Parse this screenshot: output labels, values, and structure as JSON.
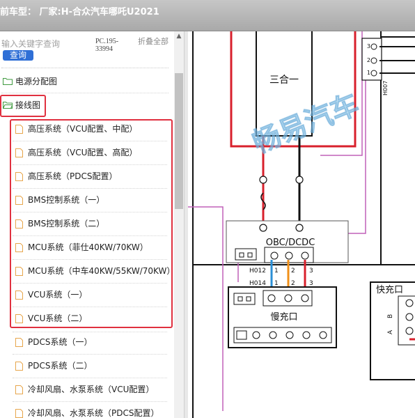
{
  "header": {
    "title": "前车型：  厂家:H-合众汽车哪吒U2021"
  },
  "search": {
    "placeholder": "输入关键字查询",
    "button_label": "查询",
    "pc_code": "PC.195-33994",
    "collapse_label": "折叠全部"
  },
  "tree": {
    "folders": [
      {
        "label": "电源分配图"
      },
      {
        "label": "接线图"
      }
    ],
    "documents": [
      {
        "label": "高压系统（VCU配置、中配）"
      },
      {
        "label": "高压系统（VCU配置、高配）"
      },
      {
        "label": "高压系统（PDCS配置）"
      },
      {
        "label": "BMS控制系统（一）"
      },
      {
        "label": "BMS控制系统（二）"
      },
      {
        "label": "MCU系统（菲仕40KW/70KW）"
      },
      {
        "label": "MCU系统（中车40KW/55KW/70KW）"
      },
      {
        "label": "VCU系统（一）"
      },
      {
        "label": "VCU系统（二）"
      },
      {
        "label": "PDCS系统（一）"
      },
      {
        "label": "PDCS系统（二）"
      },
      {
        "label": "冷却风扇、水泵系统（VCU配置）"
      },
      {
        "label": "冷却风扇、水泵系统（PDCS配置）"
      }
    ]
  },
  "diagram": {
    "module_sanheyi": "三合一",
    "module_obc": "OBC/DCDC",
    "connector_h007": "H007",
    "connector_h012": "H012",
    "connector_h014": "H014",
    "pin_1": "1",
    "pin_2": "2",
    "pin_3": "3",
    "slow_charge": "慢充口",
    "fast_charge": "快充口",
    "pin_a": "A",
    "pin_b": "B",
    "watermark": "畅易汽车"
  },
  "colors": {
    "accent": "#e0303f",
    "button": "#2f6fd6",
    "wire_red": "#d8202c",
    "wire_blue": "#2b8fd6",
    "wire_orange": "#f0901a",
    "wire_pink": "#c060b8"
  }
}
